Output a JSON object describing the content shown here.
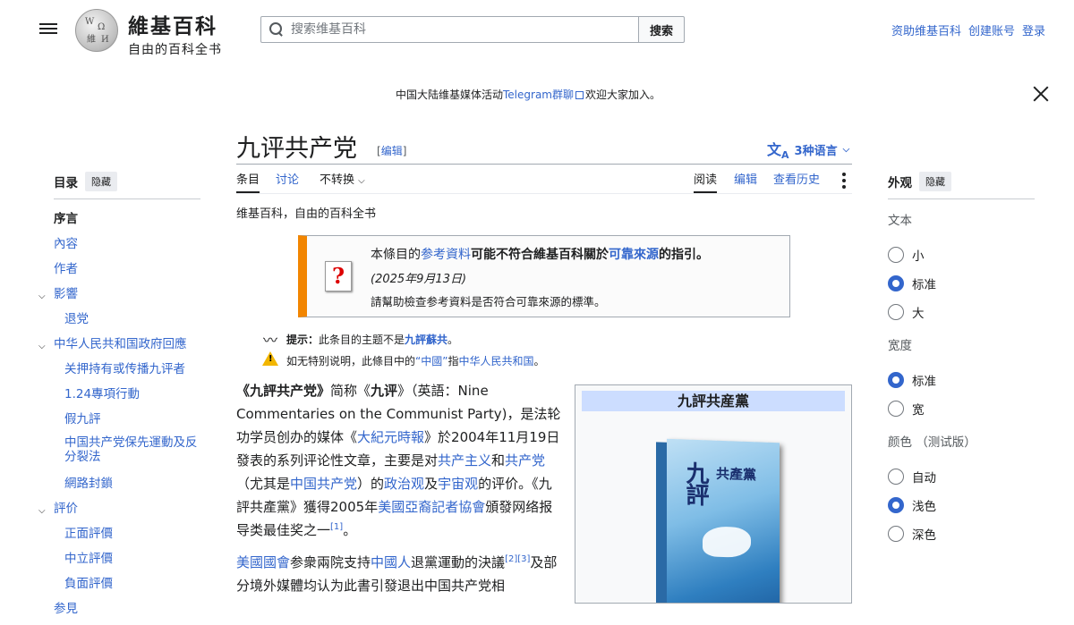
{
  "header": {
    "wordmark_title": "維基百科",
    "wordmark_tagline": "自由的百科全书",
    "search_placeholder": "搜索维基百科",
    "search_button": "搜索",
    "links": [
      "资助维基百科",
      "创建账号",
      "登录"
    ]
  },
  "notice": {
    "before": "中国大陆维基媒体活动",
    "link": "Telegram群聊",
    "after": "欢迎大家加入。"
  },
  "article": {
    "title": "九评共产党",
    "edit_label": "编辑",
    "languages": "3种语言",
    "tabs_left": [
      "条目",
      "讨论",
      "不转换"
    ],
    "tabs_right": [
      "阅读",
      "编辑",
      "查看历史"
    ],
    "tagline": "维基百科，自由的百科全书"
  },
  "toc": {
    "heading": "目录",
    "hide": "隐藏",
    "items": [
      "序言",
      "內容",
      "作者",
      "影響",
      "退党",
      "中华人民共和国政府回應",
      "关押持有或传播九评者",
      "1.24專項行動",
      "假九評",
      "中国共产党保先運動及反分裂法",
      "網路封鎖",
      "評价",
      "正面評價",
      "中立評價",
      "負面評價",
      "参見"
    ]
  },
  "ambox": {
    "l1_a": "本條目的",
    "l1_b": "参考資料",
    "l1_c": "可能不符合維基百科關於",
    "l1_d": "可靠來源",
    "l1_e": "的指引。",
    "date": "(2025年9月13日)",
    "l3": "請幫助檢查参考資料是否符合可靠來源的標準。"
  },
  "hatnotes": {
    "h1_label": "提示：",
    "h1_text": "此条目的主题不是",
    "h1_link": "九評蘇共",
    "h1_end": "。",
    "h2_a": "如无特别说明，此條目中的",
    "h2_b": "“中國”",
    "h2_c": "指",
    "h2_d": "中华人民共和国",
    "h2_e": "。"
  },
  "body": {
    "p1": [
      {
        "t": "《九評共产党》",
        "b": true
      },
      {
        "t": "简称《"
      },
      {
        "t": "九评",
        "b": true
      },
      {
        "t": "》（英語：Nine Commentaries on the Communist Party)，是法轮功学员创办的媒体《"
      },
      {
        "t": "大紀元時報",
        "l": true
      },
      {
        "t": "》於2004年11月19日發表的系列评论性文章，主要是对"
      },
      {
        "t": "共产主义",
        "l": true
      },
      {
        "t": "和"
      },
      {
        "t": "共产党",
        "l": true
      },
      {
        "t": "（尤其是"
      },
      {
        "t": "中国共产党",
        "l": true
      },
      {
        "t": "）的"
      },
      {
        "t": "政治观",
        "l": true
      },
      {
        "t": "及"
      },
      {
        "t": "宇宙观",
        "l": true
      },
      {
        "t": "的评价。《九評共產黨》獲得2005年"
      },
      {
        "t": "美國亞裔記者協會",
        "l": true
      },
      {
        "t": "頒發网络报导类最佳奖之一"
      },
      {
        "t": "[1]",
        "s": true
      },
      {
        "t": "。"
      }
    ],
    "p2": [
      {
        "t": "美國國會",
        "l": true
      },
      {
        "t": "参衆兩院支持"
      },
      {
        "t": "中國人",
        "l": true
      },
      {
        "t": "退黨運動的決議"
      },
      {
        "t": "[2][3]",
        "s": true
      },
      {
        "t": "及部分境外媒體均认为此書引發退出中国共产党相"
      }
    ]
  },
  "infobox": {
    "title": "九評共産黨",
    "cover_title": "九評",
    "cover_sub": "共產黨"
  },
  "appearance": {
    "heading": "外观",
    "hide": "隐藏",
    "text_label": "文本",
    "text_options": [
      "小",
      "标准",
      "大"
    ],
    "text_selected": 1,
    "width_label": "宽度",
    "width_options": [
      "标准",
      "宽"
    ],
    "width_selected": 0,
    "color_label": "颜色 （测试版）",
    "color_options": [
      "自动",
      "浅色",
      "深色"
    ],
    "color_selected": 1
  },
  "colors": {
    "link": "#3366cc",
    "ambox_stripe": "#f28500",
    "infobox_header": "#ccddff"
  }
}
